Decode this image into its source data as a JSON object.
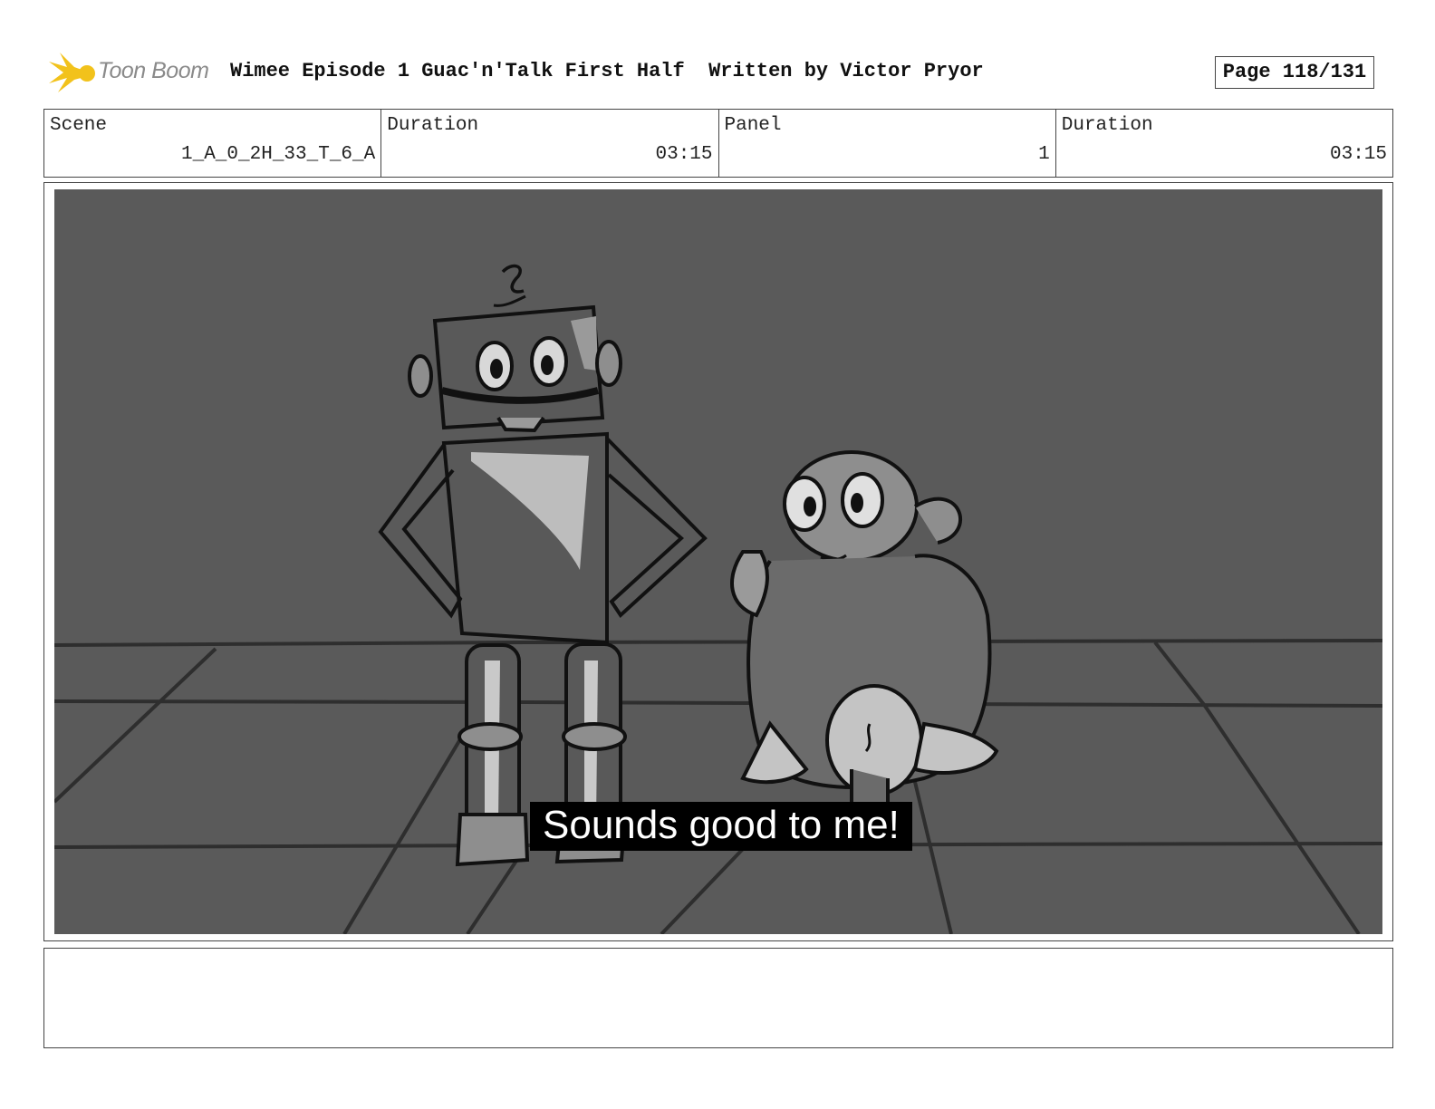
{
  "header": {
    "logo_text": "Toon Boom",
    "title": "Wimee Episode 1 Guac'n'Talk First Half  Written by Victor Pryor",
    "page": "Page 118/131"
  },
  "info": {
    "scene_label": "Scene",
    "scene_value": "1_A_0_2H_33_T_6_A",
    "scene_duration_label": "Duration",
    "scene_duration_value": "03:15",
    "panel_label": "Panel",
    "panel_value": "1",
    "panel_duration_label": "Duration",
    "panel_duration_value": "03:15"
  },
  "panel": {
    "caption": "Sounds good to me!"
  },
  "notes": {
    "text": ""
  },
  "colors": {
    "background": "#5a5a5a",
    "logo_accent": "#f2c21b",
    "caption_bg": "#000000"
  }
}
